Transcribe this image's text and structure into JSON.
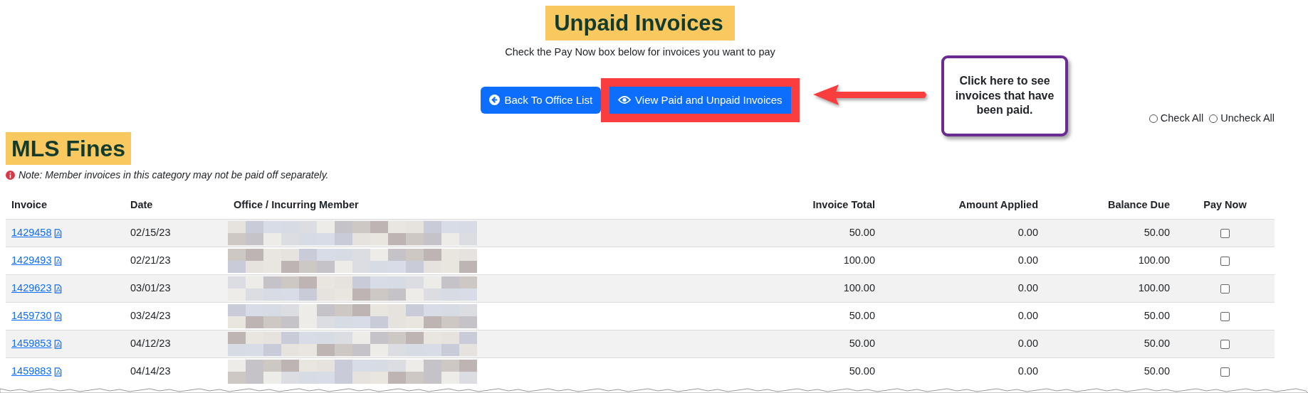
{
  "title": "Unpaid Invoices",
  "subtitle": "Check the Pay Now box below for invoices you want to pay",
  "buttons": [
    {
      "label": "Back To Office List",
      "highlighted": false
    },
    {
      "label": "View Paid and Unpaid Invoices",
      "highlighted": true
    }
  ],
  "callout": {
    "text": "Click here to see invoices that have been paid."
  },
  "select_options": [
    {
      "label": "Check All",
      "selected": false
    },
    {
      "label": "Uncheck All",
      "selected": false
    }
  ],
  "section": {
    "title": "MLS Fines",
    "note": "Note: Member invoices in this category may not be paid off separately.",
    "table": {
      "columns": [
        "Invoice",
        "Date",
        "Office / Incurring Member",
        "Invoice Total",
        "Amount Applied",
        "Balance Due",
        "Pay Now"
      ],
      "rows": [
        {
          "invoice": "1429458",
          "date": "02/15/23",
          "invoice_total": "50.00",
          "amount_applied": "0.00",
          "balance_due": "50.00",
          "pay_now": false
        },
        {
          "invoice": "1429493",
          "date": "02/21/23",
          "invoice_total": "100.00",
          "amount_applied": "0.00",
          "balance_due": "100.00",
          "pay_now": false
        },
        {
          "invoice": "1429623",
          "date": "03/01/23",
          "invoice_total": "100.00",
          "amount_applied": "0.00",
          "balance_due": "100.00",
          "pay_now": false
        },
        {
          "invoice": "1459730",
          "date": "03/24/23",
          "invoice_total": "50.00",
          "amount_applied": "0.00",
          "balance_due": "50.00",
          "pay_now": false
        },
        {
          "invoice": "1459853",
          "date": "04/12/23",
          "invoice_total": "50.00",
          "amount_applied": "0.00",
          "balance_due": "50.00",
          "pay_now": false
        },
        {
          "invoice": "1459883",
          "date": "04/14/23",
          "invoice_total": "50.00",
          "amount_applied": "0.00",
          "balance_due": "50.00",
          "pay_now": false
        }
      ]
    }
  }
}
